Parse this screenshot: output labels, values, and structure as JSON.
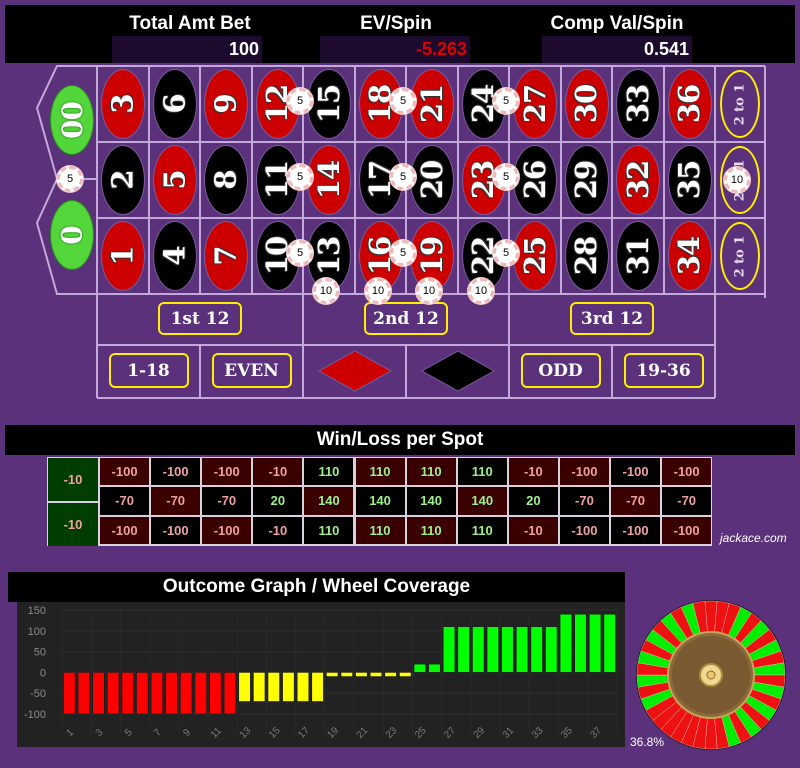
{
  "header": {
    "total_bet_label": "Total Amt Bet",
    "total_bet_value": "100",
    "ev_label": "EV/Spin",
    "ev_value": "-5.263",
    "comp_label": "Comp Val/Spin",
    "comp_value": "0.541",
    "colors": {
      "ev_value": "#e00000",
      "value_text": "#ffffff"
    }
  },
  "board": {
    "zeros": [
      {
        "label": "00",
        "color": "green"
      },
      {
        "label": "0",
        "color": "green"
      }
    ],
    "rows": [
      [
        {
          "n": "3",
          "c": "red"
        },
        {
          "n": "6",
          "c": "black"
        },
        {
          "n": "9",
          "c": "red"
        },
        {
          "n": "12",
          "c": "red"
        },
        {
          "n": "15",
          "c": "black"
        },
        {
          "n": "18",
          "c": "red"
        },
        {
          "n": "21",
          "c": "red"
        },
        {
          "n": "24",
          "c": "black"
        },
        {
          "n": "27",
          "c": "red"
        },
        {
          "n": "30",
          "c": "red"
        },
        {
          "n": "33",
          "c": "black"
        },
        {
          "n": "36",
          "c": "red"
        }
      ],
      [
        {
          "n": "2",
          "c": "black"
        },
        {
          "n": "5",
          "c": "red"
        },
        {
          "n": "8",
          "c": "black"
        },
        {
          "n": "11",
          "c": "black"
        },
        {
          "n": "14",
          "c": "red"
        },
        {
          "n": "17",
          "c": "black"
        },
        {
          "n": "20",
          "c": "black"
        },
        {
          "n": "23",
          "c": "red"
        },
        {
          "n": "26",
          "c": "black"
        },
        {
          "n": "29",
          "c": "black"
        },
        {
          "n": "32",
          "c": "red"
        },
        {
          "n": "35",
          "c": "black"
        }
      ],
      [
        {
          "n": "1",
          "c": "red"
        },
        {
          "n": "4",
          "c": "black"
        },
        {
          "n": "7",
          "c": "red"
        },
        {
          "n": "10",
          "c": "black"
        },
        {
          "n": "13",
          "c": "black"
        },
        {
          "n": "16",
          "c": "red"
        },
        {
          "n": "19",
          "c": "red"
        },
        {
          "n": "22",
          "c": "black"
        },
        {
          "n": "25",
          "c": "red"
        },
        {
          "n": "28",
          "c": "black"
        },
        {
          "n": "31",
          "c": "black"
        },
        {
          "n": "34",
          "c": "red"
        }
      ]
    ],
    "column_bets": [
      "2 to 1",
      "2 to 1",
      "2 to 1"
    ],
    "dozens": [
      "1st 12",
      "2nd 12",
      "3rd 12"
    ],
    "outside": {
      "low": "1-18",
      "even": "EVEN",
      "red": "red-diamond",
      "black": "black-diamond",
      "odd": "ODD",
      "high": "19-36"
    },
    "chips": [
      {
        "value": "5",
        "bet": "0-00 split"
      },
      {
        "value": "5",
        "bet": "12-15 split"
      },
      {
        "value": "5",
        "bet": "18-21 split"
      },
      {
        "value": "5",
        "bet": "24-27 split"
      },
      {
        "value": "5",
        "bet": "11-14 split"
      },
      {
        "value": "5",
        "bet": "17-20 split"
      },
      {
        "value": "5",
        "bet": "23-26 split"
      },
      {
        "value": "5",
        "bet": "10-13 split"
      },
      {
        "value": "5",
        "bet": "16-19 split"
      },
      {
        "value": "5",
        "bet": "22-25 split"
      },
      {
        "value": "10",
        "bet": "13-15 street"
      },
      {
        "value": "10",
        "bet": "16-18 street"
      },
      {
        "value": "10",
        "bet": "19-21 street"
      },
      {
        "value": "10",
        "bet": "22-24 street"
      },
      {
        "value": "10",
        "bet": "middle column 2 to 1"
      }
    ]
  },
  "winloss": {
    "title": "Win/Loss per Spot",
    "zeros": [
      "-10",
      "-10"
    ],
    "rows": [
      [
        "-100",
        "-100",
        "-100",
        "-10",
        "110",
        "110",
        "110",
        "110",
        "-10",
        "-100",
        "-100",
        "-100"
      ],
      [
        "-70",
        "-70",
        "-70",
        "20",
        "140",
        "140",
        "140",
        "140",
        "20",
        "-70",
        "-70",
        "-70"
      ],
      [
        "-100",
        "-100",
        "-100",
        "-10",
        "110",
        "110",
        "110",
        "110",
        "-10",
        "-100",
        "-100",
        "-100"
      ]
    ],
    "credit": "jackace.com"
  },
  "outcome": {
    "title": "Outcome Graph / Wheel Coverage",
    "coverage": "36.8%"
  },
  "chart_data": {
    "type": "bar",
    "title": "Outcome Graph / Wheel Coverage",
    "xlabel": "",
    "ylabel": "",
    "ylim": [
      -100,
      150
    ],
    "yticks": [
      150,
      100,
      50,
      0,
      -50,
      -100
    ],
    "xticks": [
      "1",
      "3",
      "5",
      "7",
      "9",
      "11",
      "13",
      "15",
      "17",
      "19",
      "21",
      "23",
      "25",
      "27",
      "29",
      "31",
      "33",
      "35",
      "37"
    ],
    "grid": true,
    "categories": [
      "1",
      "2",
      "3",
      "4",
      "5",
      "6",
      "7",
      "8",
      "9",
      "10",
      "11",
      "12",
      "13",
      "14",
      "15",
      "16",
      "17",
      "18",
      "19",
      "20",
      "21",
      "22",
      "23",
      "24",
      "25",
      "26",
      "27",
      "28",
      "29",
      "30",
      "31",
      "32",
      "33",
      "34",
      "35",
      "36",
      "37",
      "38"
    ],
    "values": [
      -100,
      -100,
      -100,
      -100,
      -100,
      -100,
      -100,
      -100,
      -100,
      -100,
      -100,
      -100,
      -70,
      -70,
      -70,
      -70,
      -70,
      -70,
      -10,
      -10,
      -10,
      -10,
      -10,
      -10,
      20,
      20,
      110,
      110,
      110,
      110,
      110,
      110,
      110,
      110,
      140,
      140,
      140,
      140
    ],
    "colors": {
      "loss_full": "#ff0000",
      "loss_partial": "#ffff00",
      "win": "#00ff00"
    }
  }
}
